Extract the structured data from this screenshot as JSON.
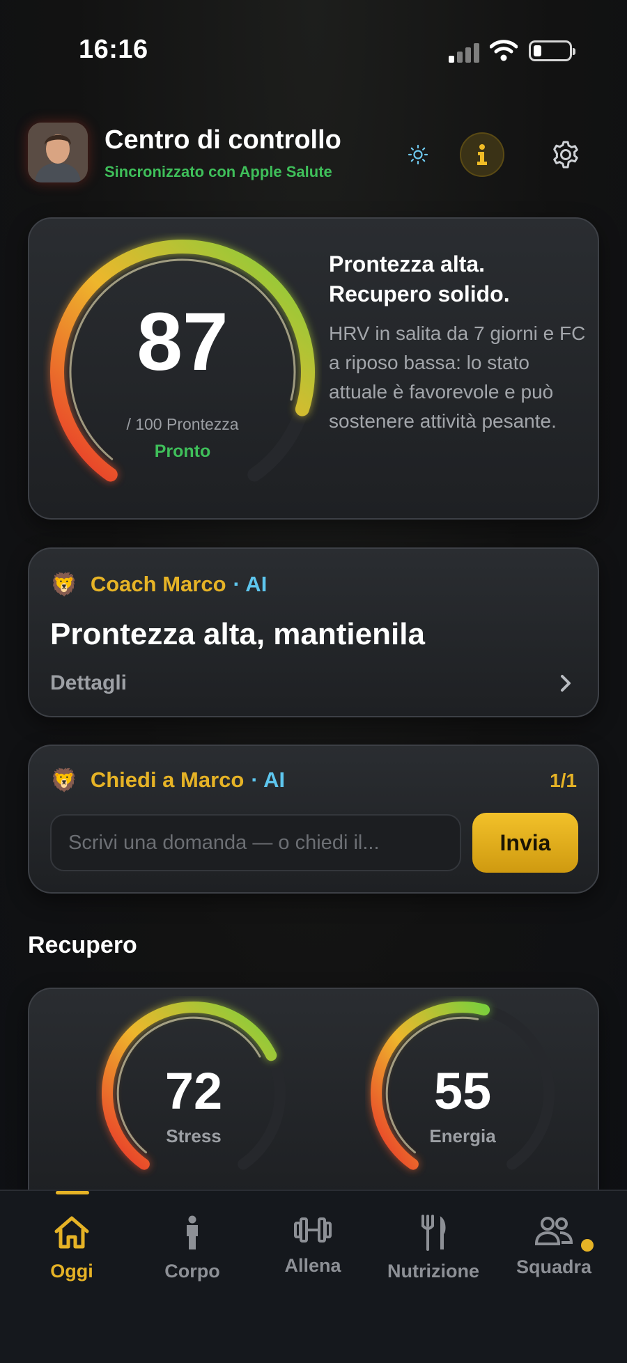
{
  "status_bar": {
    "time": "16:16"
  },
  "header": {
    "title": "Centro di controllo",
    "subtitle": "Sincronizzato con Apple Salute"
  },
  "readiness": {
    "value": "87",
    "level": 0.87,
    "sub_label": "/ 100 Prontezza",
    "status": "Pronto",
    "headline": "Prontezza alta. Recupero solido.",
    "description": "HRV in salita da 7 giorni e FC a riposo bassa: lo stato attuale è favorevole e può sostenere attività pesante."
  },
  "coach": {
    "name": "Coach Marco",
    "ai_tag": "· AI",
    "title": "Prontezza alta, mantienila",
    "details_label": "Dettagli"
  },
  "ask": {
    "name": "Chiedi a Marco",
    "ai_tag": "· AI",
    "count": "1/1",
    "placeholder": "Scrivi una domanda — o chiedi il...",
    "send_label": "Invia"
  },
  "recovery": {
    "section_title": "Recupero",
    "stress": {
      "value": "72",
      "level": 0.72,
      "label": "Stress"
    },
    "energy": {
      "value": "55",
      "level": 0.55,
      "label": "Energia"
    }
  },
  "tabs": [
    {
      "label": "Oggi",
      "icon": "home-icon",
      "active": true
    },
    {
      "label": "Corpo",
      "icon": "person-icon"
    },
    {
      "label": "Allena",
      "icon": "dumbbell-icon"
    },
    {
      "label": "Nutrizione",
      "icon": "fork-knife-icon"
    },
    {
      "label": "Squadra",
      "icon": "group-icon",
      "badge": true
    }
  ],
  "colors": {
    "accent": "#e6b326",
    "success": "#3fbf5a",
    "ai": "#5ec6ee",
    "gauge_low": "#e8322a",
    "gauge_mid": "#eeb62c",
    "gauge_high": "#7ccf3c"
  }
}
